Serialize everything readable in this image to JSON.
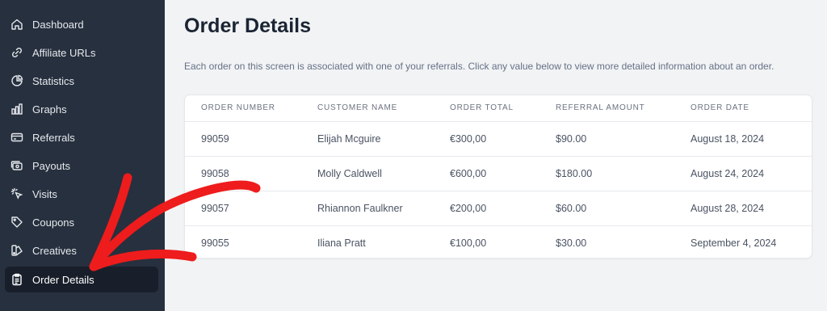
{
  "sidebar": {
    "items": [
      {
        "label": "Dashboard",
        "icon": "home-icon"
      },
      {
        "label": "Affiliate URLs",
        "icon": "link-icon"
      },
      {
        "label": "Statistics",
        "icon": "pie-chart-icon"
      },
      {
        "label": "Graphs",
        "icon": "bar-chart-icon"
      },
      {
        "label": "Referrals",
        "icon": "credit-card-icon"
      },
      {
        "label": "Payouts",
        "icon": "payout-icon"
      },
      {
        "label": "Visits",
        "icon": "cursor-click-icon"
      },
      {
        "label": "Coupons",
        "icon": "tag-icon"
      },
      {
        "label": "Creatives",
        "icon": "creatives-icon"
      },
      {
        "label": "Order Details",
        "icon": "clipboard-icon",
        "active": true
      }
    ]
  },
  "main": {
    "title": "Order Details",
    "intro": "Each order on this screen is associated with one of your referrals. Click any value below to view more detailed information about an order."
  },
  "table": {
    "headers": [
      "ORDER NUMBER",
      "CUSTOMER NAME",
      "ORDER TOTAL",
      "REFERRAL AMOUNT",
      "ORDER DATE"
    ],
    "rows": [
      [
        "99059",
        "Elijah Mcguire",
        "€300,00",
        "$90.00",
        "August 18, 2024"
      ],
      [
        "99058",
        "Molly Caldwell",
        "€600,00",
        "$180.00",
        "August 24, 2024"
      ],
      [
        "99057",
        "Rhiannon Faulkner",
        "€200,00",
        "$60.00",
        "August 28, 2024"
      ],
      [
        "99055",
        "Iliana Pratt",
        "€100,00",
        "$30.00",
        "September 4, 2024"
      ]
    ]
  },
  "colors": {
    "sidebar_bg": "#27303e",
    "active_bg": "#181f2a",
    "annotation_arrow": "#ee1c1c"
  }
}
